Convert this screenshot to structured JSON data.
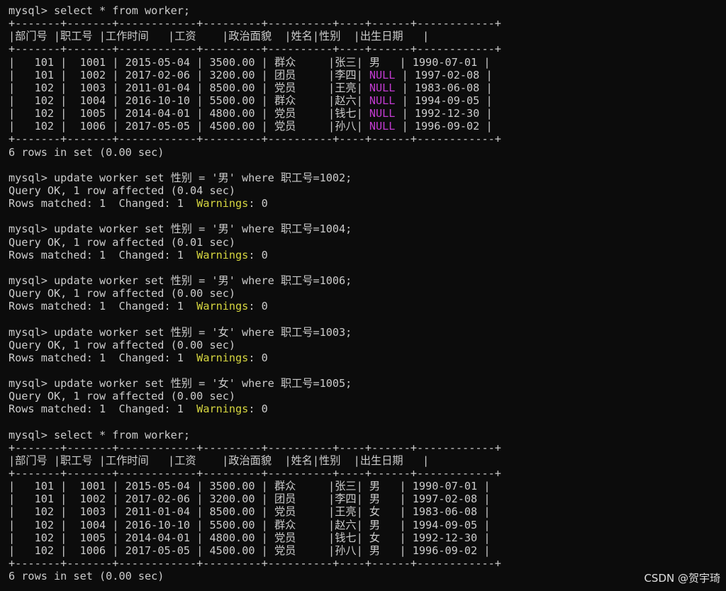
{
  "terminal": {
    "prompt": "mysql> ",
    "query1": "select * from worker;",
    "table1": {
      "border": "+-------+-------+------------+---------+----------+----+------+------------+",
      "headers": [
        "部门号",
        "职工号",
        "工作时间",
        "工资",
        "政治面貌",
        "姓名",
        "性别",
        "出生日期"
      ],
      "rows": [
        [
          "101",
          "1001",
          "2015-05-04",
          "3500.00",
          "群众",
          "张三",
          "男",
          "1990-07-01"
        ],
        [
          "101",
          "1002",
          "2017-02-06",
          "3200.00",
          "团员",
          "李四",
          "NULL",
          "1997-02-08"
        ],
        [
          "102",
          "1003",
          "2011-01-04",
          "8500.00",
          "党员",
          "王亮",
          "NULL",
          "1983-06-08"
        ],
        [
          "102",
          "1004",
          "2016-10-10",
          "5500.00",
          "群众",
          "赵六",
          "NULL",
          "1994-09-05"
        ],
        [
          "102",
          "1005",
          "2014-04-01",
          "4800.00",
          "党员",
          "钱七",
          "NULL",
          "1992-12-30"
        ],
        [
          "102",
          "1006",
          "2017-05-05",
          "4500.00",
          "党员",
          "孙八",
          "NULL",
          "1996-09-02"
        ]
      ],
      "footer": "6 rows in set (0.00 sec)"
    },
    "updates": [
      {
        "command": "update worker set 性别 = '男' where 职工号=1002;",
        "result": "Query OK, 1 row affected (0.04 sec)",
        "matched": "Rows matched: 1  Changed: 1  ",
        "warnings_label": "Warnings",
        "warnings_value": ": 0"
      },
      {
        "command": "update worker set 性别 = '男' where 职工号=1004;",
        "result": "Query OK, 1 row affected (0.01 sec)",
        "matched": "Rows matched: 1  Changed: 1  ",
        "warnings_label": "Warnings",
        "warnings_value": ": 0"
      },
      {
        "command": "update worker set 性别 = '男' where 职工号=1006;",
        "result": "Query OK, 1 row affected (0.00 sec)",
        "matched": "Rows matched: 1  Changed: 1  ",
        "warnings_label": "Warnings",
        "warnings_value": ": 0"
      },
      {
        "command": "update worker set 性别 = '女' where 职工号=1003;",
        "result": "Query OK, 1 row affected (0.00 sec)",
        "matched": "Rows matched: 1  Changed: 1  ",
        "warnings_label": "Warnings",
        "warnings_value": ": 0"
      },
      {
        "command": "update worker set 性别 = '女' where 职工号=1005;",
        "result": "Query OK, 1 row affected (0.00 sec)",
        "matched": "Rows matched: 1  Changed: 1  ",
        "warnings_label": "Warnings",
        "warnings_value": ": 0"
      }
    ],
    "query2": "select * from worker;",
    "table2": {
      "border": "+-------+-------+------------+---------+----------+----+------+------------+",
      "headers": [
        "部门号",
        "职工号",
        "工作时间",
        "工资",
        "政治面貌",
        "姓名",
        "性别",
        "出生日期"
      ],
      "rows": [
        [
          "101",
          "1001",
          "2015-05-04",
          "3500.00",
          "群众",
          "张三",
          "男",
          "1990-07-01"
        ],
        [
          "101",
          "1002",
          "2017-02-06",
          "3200.00",
          "团员",
          "李四",
          "男",
          "1997-02-08"
        ],
        [
          "102",
          "1003",
          "2011-01-04",
          "8500.00",
          "党员",
          "王亮",
          "女",
          "1983-06-08"
        ],
        [
          "102",
          "1004",
          "2016-10-10",
          "5500.00",
          "群众",
          "赵六",
          "男",
          "1994-09-05"
        ],
        [
          "102",
          "1005",
          "2014-04-01",
          "4800.00",
          "党员",
          "钱七",
          "女",
          "1992-12-30"
        ],
        [
          "102",
          "1006",
          "2017-05-05",
          "4500.00",
          "党员",
          "孙八",
          "男",
          "1996-09-02"
        ]
      ],
      "footer": "6 rows in set (0.00 sec)"
    }
  },
  "watermark": "CSDN @贺宇琦",
  "colors": {
    "background": "#0c0c0c",
    "text": "#cccccc",
    "null": "#c33bd2",
    "warnings": "#d7d740"
  }
}
